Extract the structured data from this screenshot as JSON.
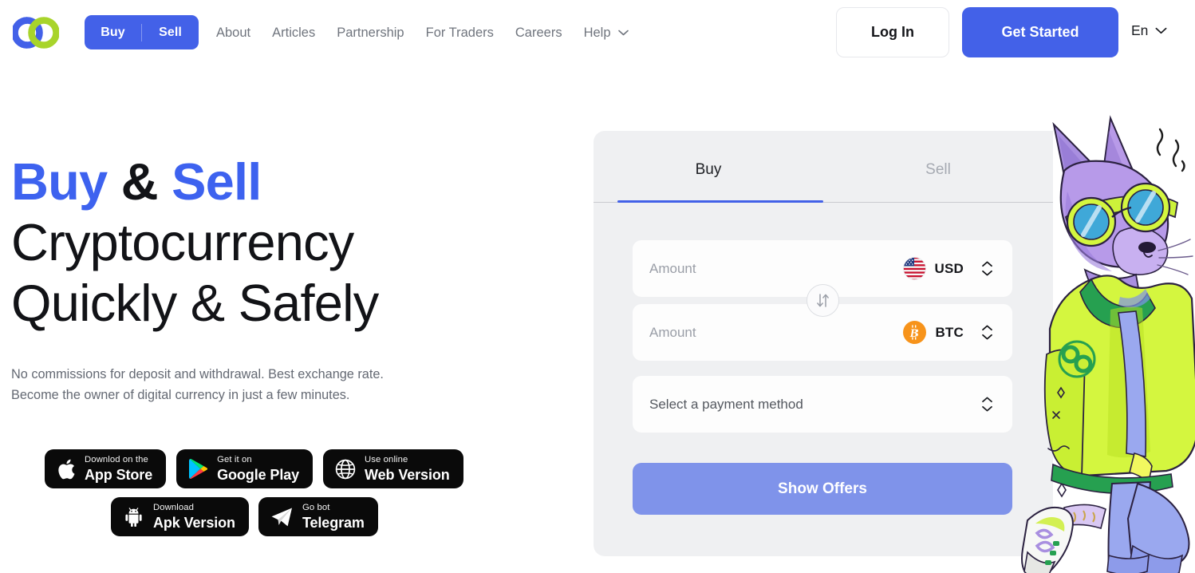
{
  "header": {
    "logo": "infinity-rings-logo",
    "trade_toggle": {
      "buy_label": "Buy",
      "sell_label": "Sell"
    },
    "nav_items": [
      {
        "label": "About"
      },
      {
        "label": "Articles"
      },
      {
        "label": "Partnership"
      },
      {
        "label": "For Traders"
      },
      {
        "label": "Careers"
      },
      {
        "label": "Help",
        "has_dropdown": true
      }
    ],
    "login_label": "Log In",
    "get_started_label": "Get Started",
    "language": "En"
  },
  "hero": {
    "title_buy": "Buy",
    "title_amp": " & ",
    "title_sell": "Sell",
    "title_line2": "Cryptocurrency",
    "title_line3": "Quickly & Safely",
    "subtitle_line1": "No commissions for deposit and withdrawal. Best exchange rate.",
    "subtitle_line2": "Become the owner of digital currency in just a few minutes."
  },
  "badges": [
    {
      "small": "Downlod on the",
      "big": "App Store",
      "icon": "apple-icon"
    },
    {
      "small": "Get it on",
      "big": "Google Play",
      "icon": "google-play-icon"
    },
    {
      "small": "Use online",
      "big": "Web Version",
      "icon": "globe-icon"
    },
    {
      "small": "Download",
      "big": "Apk Version",
      "icon": "android-icon"
    },
    {
      "small": "Go bot",
      "big": "Telegram",
      "icon": "telegram-icon"
    }
  ],
  "exchange": {
    "tabs": [
      {
        "label": "Buy",
        "active": true
      },
      {
        "label": "Sell",
        "active": false
      }
    ],
    "amount_from": {
      "placeholder": "Amount",
      "value": "",
      "currency": "USD",
      "currency_icon": "us-flag-icon"
    },
    "amount_to": {
      "placeholder": "Amount",
      "value": "",
      "currency": "BTC",
      "currency_icon": "bitcoin-icon"
    },
    "payment_method": {
      "placeholder": "Select a payment method",
      "value": ""
    },
    "swap_icon": "swap-vertical-icon",
    "submit_label": "Show Offers"
  },
  "mascot": {
    "name": "purple-cat-mascot"
  },
  "colors": {
    "brand_blue": "#4361e8",
    "hero_blue": "#3d62ef",
    "logo_green": "#a8d42b",
    "card_bg": "#eff0f2",
    "submit_blue": "#7f93ea",
    "bitcoin_orange": "#f7931a",
    "nav_gray": "#70757e"
  }
}
